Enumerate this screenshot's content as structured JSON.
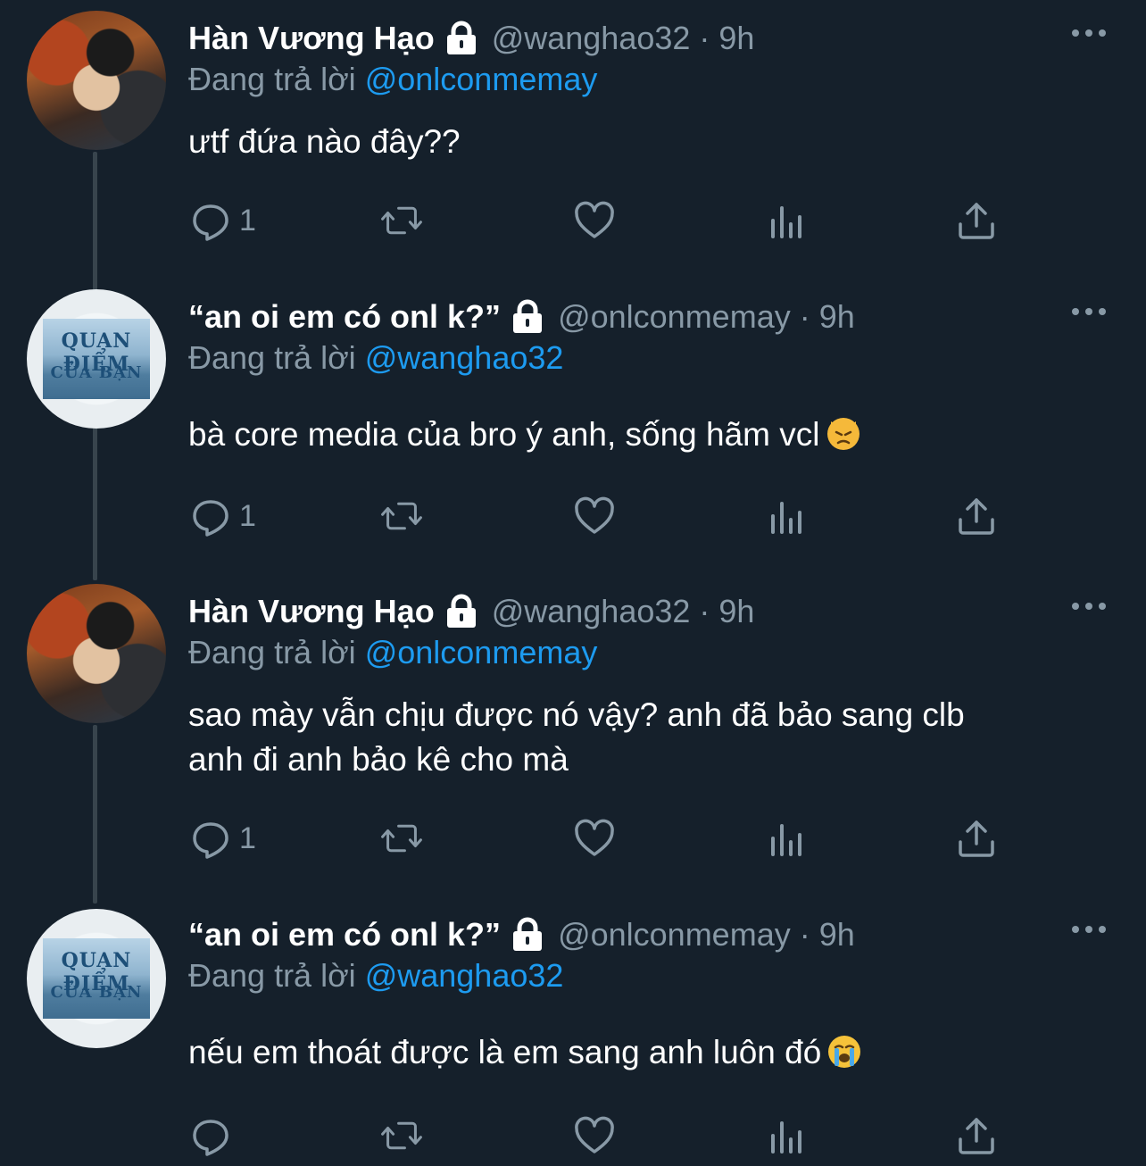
{
  "colors": {
    "background": "#15202b",
    "name": "#ffffff",
    "muted": "#8899a6",
    "link": "#1d9bf0",
    "thread_line": "#38444d"
  },
  "tweets": [
    {
      "avatar": "avatar-photo",
      "display_name": "Hàn Vương Hạo",
      "handle_time": "@wanghao32 · 9h",
      "reply_prefix": "Đang trả lời",
      "reply_to": "@onlconmemay",
      "body_lines": [
        "ưtf đứa nào đây??"
      ],
      "emoji": "",
      "reply_count": "1"
    },
    {
      "avatar": "avatar-poster",
      "display_name": "“an oi em có onl k?”",
      "handle_time": "@onlconmemay · 9h",
      "reply_prefix": "Đang trả lời",
      "reply_to": "@wanghao32",
      "body_lines": [
        "bà core media của bro ý anh, sống hãm vcl"
      ],
      "emoji": "pouting-cat-emoji",
      "reply_count": "1"
    },
    {
      "avatar": "avatar-photo",
      "display_name": "Hàn Vương Hạo",
      "handle_time": "@wanghao32 · 9h",
      "reply_prefix": "Đang trả lời",
      "reply_to": "@onlconmemay",
      "body_lines": [
        "sao mày vẫn chịu được nó vậy? anh đã bảo sang clb",
        "anh đi anh bảo kê cho mà"
      ],
      "emoji": "",
      "reply_count": "1"
    },
    {
      "avatar": "avatar-poster",
      "display_name": "“an oi em có onl k?”",
      "handle_time": "@onlconmemay · 9h",
      "reply_prefix": "Đang trả lời",
      "reply_to": "@wanghao32",
      "body_lines": [
        "nếu em thoát được là em sang anh luôn đó"
      ],
      "emoji": "loudly-crying-emoji",
      "reply_count": ""
    }
  ],
  "poster": {
    "line1": "QUAN ĐIỂM",
    "line2": "CỦA BẠN"
  }
}
